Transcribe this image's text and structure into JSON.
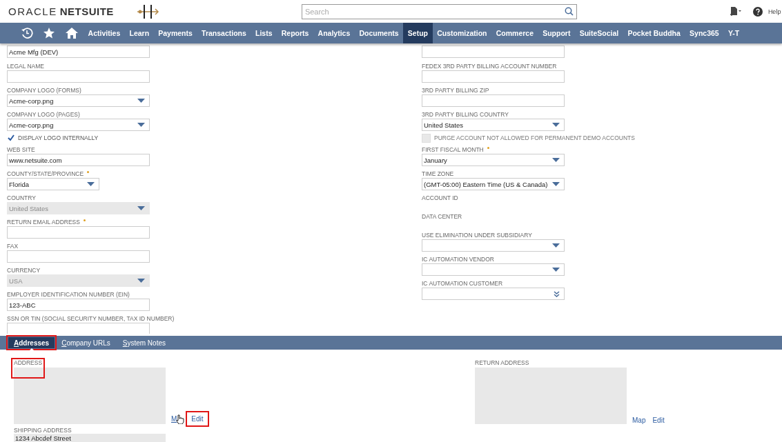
{
  "header": {
    "brand": "ORACLE",
    "product": "NETSUITE",
    "search": {
      "placeholder": "Search"
    },
    "help": "Help"
  },
  "nav": [
    {
      "kind": "recent",
      "selected": false
    },
    {
      "kind": "star",
      "selected": false
    },
    {
      "kind": "home",
      "selected": false
    },
    {
      "label": "Activities",
      "selected": false
    },
    {
      "label": "Learn",
      "selected": false
    },
    {
      "label": "Payments",
      "selected": false
    },
    {
      "label": "Transactions",
      "selected": false
    },
    {
      "label": "Lists",
      "selected": false
    },
    {
      "label": "Reports",
      "selected": false
    },
    {
      "label": "Analytics",
      "selected": false
    },
    {
      "label": "Documents",
      "selected": false
    },
    {
      "label": "Setup",
      "selected": true
    },
    {
      "label": "Customization",
      "selected": false
    },
    {
      "label": "Commerce",
      "selected": false
    },
    {
      "label": "Support",
      "selected": false
    },
    {
      "label": "SuiteSocial",
      "selected": false
    },
    {
      "label": "Pocket Buddha",
      "selected": false
    },
    {
      "label": "Sync365",
      "selected": false
    },
    {
      "label": "Y-T",
      "selected": false
    }
  ],
  "left_fields": [
    {
      "kind": "text",
      "value": "Acme Mfg (DEV)"
    },
    {
      "kind": "text",
      "label": "LEGAL NAME"
    },
    {
      "kind": "select",
      "label": "COMPANY LOGO (FORMS)",
      "value": "Acme-corp.png"
    },
    {
      "kind": "select",
      "label": "COMPANY LOGO (PAGES)",
      "value": "Acme-corp.png"
    },
    {
      "kind": "checkbox",
      "label": "DISPLAY LOGO INTERNALLY",
      "checked": true,
      "disabled": false
    },
    {
      "kind": "text",
      "label": "WEB SITE",
      "value": "www.netsuite.com"
    },
    {
      "kind": "select-short",
      "label": "COUNTY/STATE/PROVINCE",
      "required": true,
      "value": "Florida"
    },
    {
      "kind": "select",
      "label": "COUNTRY",
      "value": "United States",
      "disabled": true
    },
    {
      "kind": "text",
      "label": "RETURN EMAIL ADDRESS",
      "required": true
    },
    {
      "kind": "text",
      "label": "FAX"
    },
    {
      "kind": "select",
      "label": "CURRENCY",
      "value": "USA",
      "disabled": true
    },
    {
      "kind": "text",
      "label": "EMPLOYER IDENTIFICATION NUMBER (EIN)",
      "value": "123-ABC"
    },
    {
      "kind": "text",
      "label": "SSN OR TIN (SOCIAL SECURITY NUMBER, TAX ID NUMBER)"
    }
  ],
  "right_fields": [
    {
      "kind": "text"
    },
    {
      "kind": "text",
      "label": "FEDEX 3RD PARTY BILLING ACCOUNT NUMBER"
    },
    {
      "kind": "text",
      "label": "3RD PARTY BILLING ZIP"
    },
    {
      "kind": "select",
      "label": "3RD PARTY BILLING COUNTRY",
      "value": "United States"
    },
    {
      "kind": "checkbox",
      "label": "PURGE ACCOUNT NOT ALLOWED FOR PERMANENT DEMO ACCOUNTS",
      "checked": false,
      "disabled": true
    },
    {
      "kind": "select",
      "label": "FIRST FISCAL MONTH",
      "required": true,
      "value": "January"
    },
    {
      "kind": "select",
      "label": "TIME ZONE",
      "value": "(GMT-05:00) Eastern Time (US & Canada)"
    },
    {
      "kind": "static",
      "label": "ACCOUNT ID"
    },
    {
      "kind": "static",
      "label": "DATA CENTER"
    },
    {
      "kind": "select",
      "label": "USE ELIMINATION UNDER SUBSIDIARY"
    },
    {
      "kind": "select",
      "label": "IC AUTOMATION VENDOR"
    },
    {
      "kind": "multiselect",
      "label": "IC AUTOMATION CUSTOMER"
    }
  ],
  "subtabs": [
    {
      "label": "Addresses",
      "selected": true,
      "highlighted": true
    },
    {
      "label": "Company URLs",
      "selected": false,
      "highlighted": false
    },
    {
      "label": "System Notes",
      "selected": false,
      "highlighted": false
    }
  ],
  "addresses": [
    {
      "label": "ADDRESS",
      "highlighted": true,
      "links": [
        {
          "label": "M",
          "highlighted": false
        },
        {
          "label": "Edit",
          "highlighted": true
        }
      ],
      "cursor": true,
      "extra": {
        "label": "SHIPPING ADDRESS",
        "value": "1234 Abcdef Street"
      }
    },
    {
      "label": "RETURN ADDRESS",
      "highlighted": false,
      "links": [
        {
          "label": "Map",
          "highlighted": false
        },
        {
          "label": "Edit",
          "highlighted": false
        }
      ]
    }
  ]
}
